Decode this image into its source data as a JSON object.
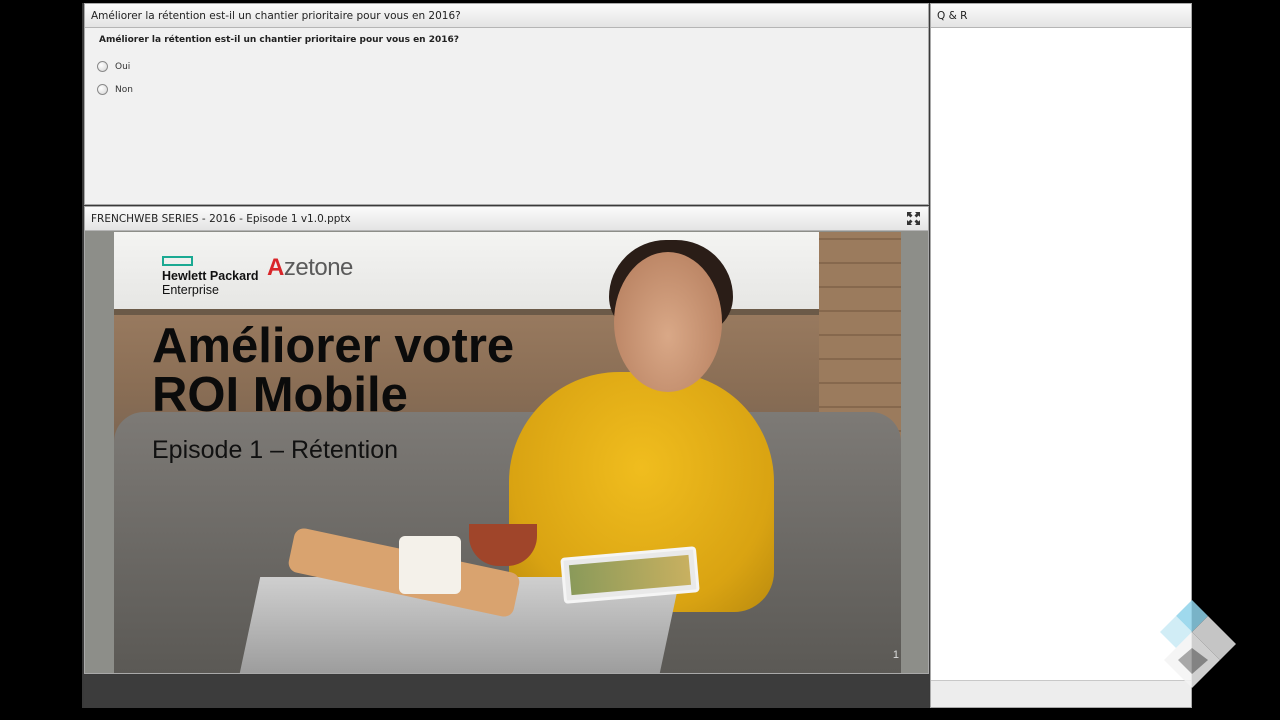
{
  "poll": {
    "header_title": "Améliorer la rétention est-il un chantier prioritaire pour vous en 2016?",
    "question": "Améliorer la rétention est-il un chantier prioritaire pour vous en 2016?",
    "options": [
      "Oui",
      "Non"
    ]
  },
  "share": {
    "header_title": "FRENCHWEB SERIES - 2016 - Episode 1 v1.0.pptx",
    "slide": {
      "logo_hpe_line1": "Hewlett Packard",
      "logo_hpe_line2": "Enterprise",
      "logo_azetone_a": "A",
      "logo_azetone_rest": "zetone",
      "title_line1": "Améliorer votre",
      "title_line2": "ROI Mobile",
      "subtitle": "Episode 1 – Rétention",
      "page_number": "1"
    }
  },
  "qa": {
    "header_title": "Q & R"
  },
  "colors": {
    "hpe_green": "#1aa992",
    "azetone_red": "#d9262a",
    "sweater_yellow": "#f0bd1e"
  }
}
